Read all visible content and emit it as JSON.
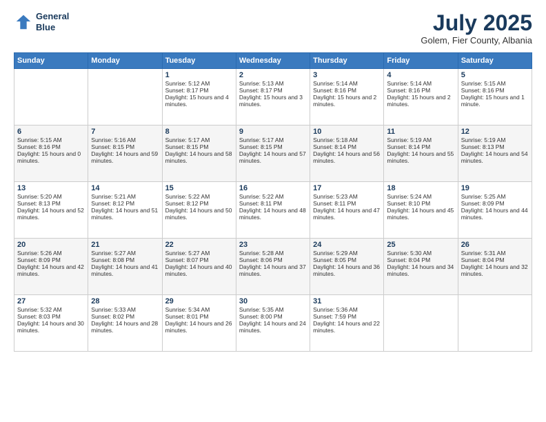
{
  "logo": {
    "line1": "General",
    "line2": "Blue"
  },
  "title": "July 2025",
  "subtitle": "Golem, Fier County, Albania",
  "weekdays": [
    "Sunday",
    "Monday",
    "Tuesday",
    "Wednesday",
    "Thursday",
    "Friday",
    "Saturday"
  ],
  "weeks": [
    [
      null,
      null,
      {
        "day": "1",
        "sunrise": "5:12 AM",
        "sunset": "8:17 PM",
        "daylight": "15 hours and 4 minutes."
      },
      {
        "day": "2",
        "sunrise": "5:13 AM",
        "sunset": "8:17 PM",
        "daylight": "15 hours and 3 minutes."
      },
      {
        "day": "3",
        "sunrise": "5:14 AM",
        "sunset": "8:16 PM",
        "daylight": "15 hours and 2 minutes."
      },
      {
        "day": "4",
        "sunrise": "5:14 AM",
        "sunset": "8:16 PM",
        "daylight": "15 hours and 2 minutes."
      },
      {
        "day": "5",
        "sunrise": "5:15 AM",
        "sunset": "8:16 PM",
        "daylight": "15 hours and 1 minute."
      }
    ],
    [
      {
        "day": "6",
        "sunrise": "5:15 AM",
        "sunset": "8:16 PM",
        "daylight": "15 hours and 0 minutes."
      },
      {
        "day": "7",
        "sunrise": "5:16 AM",
        "sunset": "8:15 PM",
        "daylight": "14 hours and 59 minutes."
      },
      {
        "day": "8",
        "sunrise": "5:17 AM",
        "sunset": "8:15 PM",
        "daylight": "14 hours and 58 minutes."
      },
      {
        "day": "9",
        "sunrise": "5:17 AM",
        "sunset": "8:15 PM",
        "daylight": "14 hours and 57 minutes."
      },
      {
        "day": "10",
        "sunrise": "5:18 AM",
        "sunset": "8:14 PM",
        "daylight": "14 hours and 56 minutes."
      },
      {
        "day": "11",
        "sunrise": "5:19 AM",
        "sunset": "8:14 PM",
        "daylight": "14 hours and 55 minutes."
      },
      {
        "day": "12",
        "sunrise": "5:19 AM",
        "sunset": "8:13 PM",
        "daylight": "14 hours and 54 minutes."
      }
    ],
    [
      {
        "day": "13",
        "sunrise": "5:20 AM",
        "sunset": "8:13 PM",
        "daylight": "14 hours and 52 minutes."
      },
      {
        "day": "14",
        "sunrise": "5:21 AM",
        "sunset": "8:12 PM",
        "daylight": "14 hours and 51 minutes."
      },
      {
        "day": "15",
        "sunrise": "5:22 AM",
        "sunset": "8:12 PM",
        "daylight": "14 hours and 50 minutes."
      },
      {
        "day": "16",
        "sunrise": "5:22 AM",
        "sunset": "8:11 PM",
        "daylight": "14 hours and 48 minutes."
      },
      {
        "day": "17",
        "sunrise": "5:23 AM",
        "sunset": "8:11 PM",
        "daylight": "14 hours and 47 minutes."
      },
      {
        "day": "18",
        "sunrise": "5:24 AM",
        "sunset": "8:10 PM",
        "daylight": "14 hours and 45 minutes."
      },
      {
        "day": "19",
        "sunrise": "5:25 AM",
        "sunset": "8:09 PM",
        "daylight": "14 hours and 44 minutes."
      }
    ],
    [
      {
        "day": "20",
        "sunrise": "5:26 AM",
        "sunset": "8:09 PM",
        "daylight": "14 hours and 42 minutes."
      },
      {
        "day": "21",
        "sunrise": "5:27 AM",
        "sunset": "8:08 PM",
        "daylight": "14 hours and 41 minutes."
      },
      {
        "day": "22",
        "sunrise": "5:27 AM",
        "sunset": "8:07 PM",
        "daylight": "14 hours and 40 minutes."
      },
      {
        "day": "23",
        "sunrise": "5:28 AM",
        "sunset": "8:06 PM",
        "daylight": "14 hours and 37 minutes."
      },
      {
        "day": "24",
        "sunrise": "5:29 AM",
        "sunset": "8:05 PM",
        "daylight": "14 hours and 36 minutes."
      },
      {
        "day": "25",
        "sunrise": "5:30 AM",
        "sunset": "8:04 PM",
        "daylight": "14 hours and 34 minutes."
      },
      {
        "day": "26",
        "sunrise": "5:31 AM",
        "sunset": "8:04 PM",
        "daylight": "14 hours and 32 minutes."
      }
    ],
    [
      {
        "day": "27",
        "sunrise": "5:32 AM",
        "sunset": "8:03 PM",
        "daylight": "14 hours and 30 minutes."
      },
      {
        "day": "28",
        "sunrise": "5:33 AM",
        "sunset": "8:02 PM",
        "daylight": "14 hours and 28 minutes."
      },
      {
        "day": "29",
        "sunrise": "5:34 AM",
        "sunset": "8:01 PM",
        "daylight": "14 hours and 26 minutes."
      },
      {
        "day": "30",
        "sunrise": "5:35 AM",
        "sunset": "8:00 PM",
        "daylight": "14 hours and 24 minutes."
      },
      {
        "day": "31",
        "sunrise": "5:36 AM",
        "sunset": "7:59 PM",
        "daylight": "14 hours and 22 minutes."
      },
      null,
      null
    ]
  ]
}
